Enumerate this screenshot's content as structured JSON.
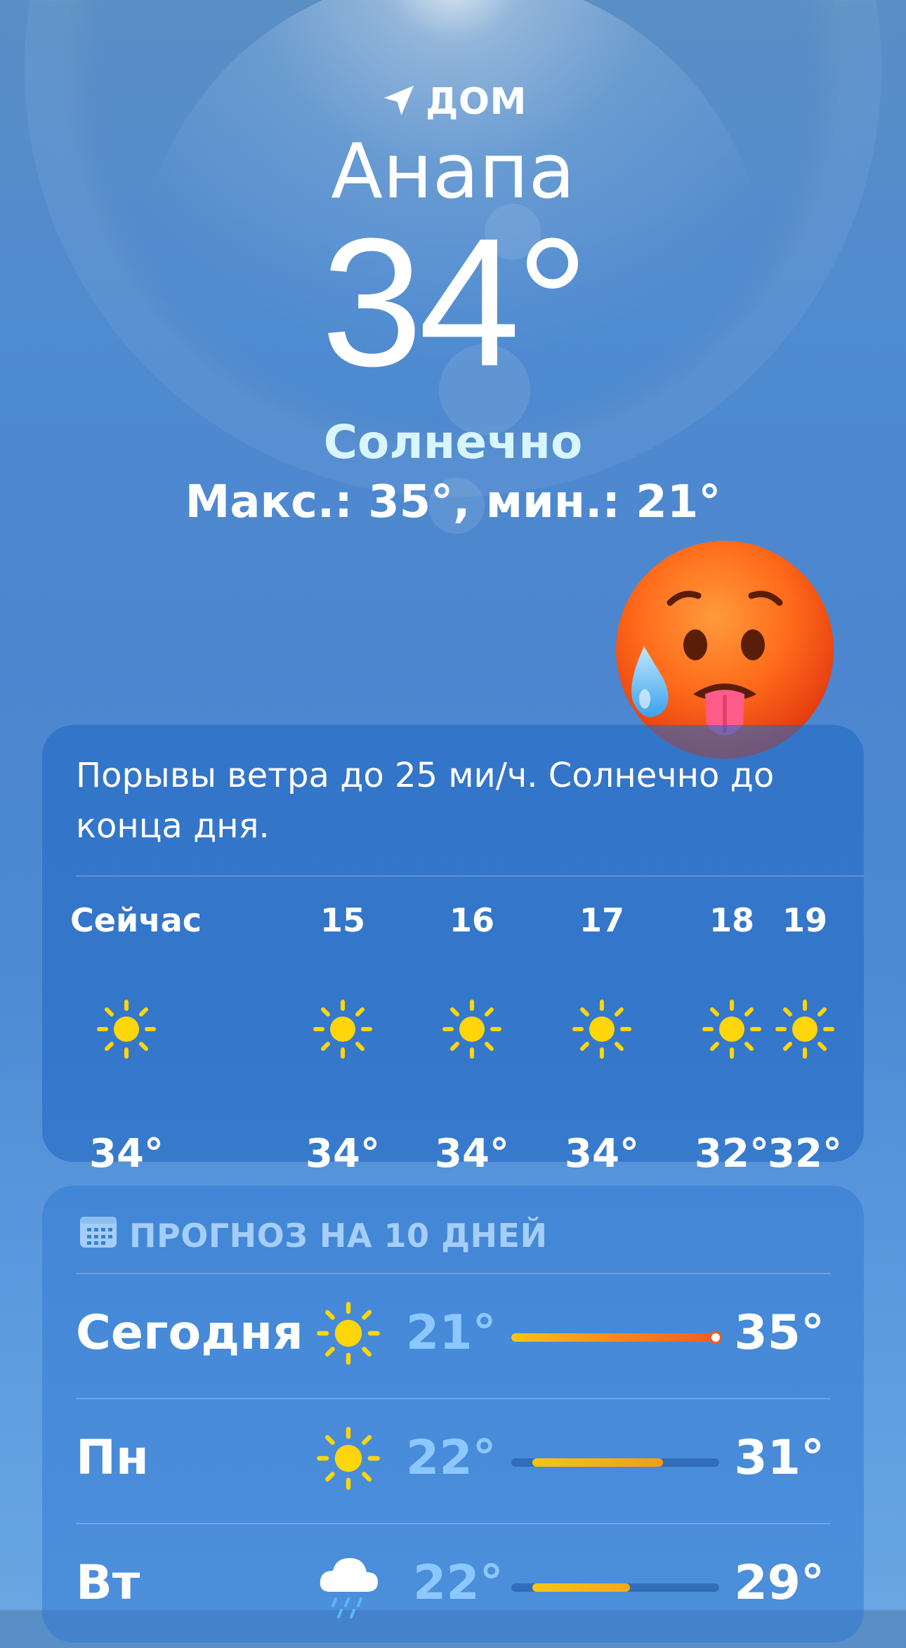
{
  "location": {
    "label": "ДОМ",
    "city": "Анапа",
    "temperature": "34°",
    "condition": "Солнечно",
    "high_low": "Макс.: 35°, мин.: 21°"
  },
  "emoji": "hot-face-with-sweat",
  "hourly": {
    "summary": "Порывы ветра до 25 ми/ч. Солнечно до конца дня.",
    "hours": [
      {
        "label": "Сейчас",
        "icon": "sun-icon",
        "temp": "34°"
      },
      {
        "label": "15",
        "icon": "sun-icon",
        "temp": "34°"
      },
      {
        "label": "16",
        "icon": "sun-icon",
        "temp": "34°"
      },
      {
        "label": "17",
        "icon": "sun-icon",
        "temp": "34°"
      },
      {
        "label": "18",
        "icon": "sun-icon",
        "temp": "32°"
      },
      {
        "label": "19",
        "icon": "sun-icon",
        "temp": "32°"
      }
    ]
  },
  "daily": {
    "title": "ПРОГНОЗ НА 10 ДНЕЙ",
    "days": [
      {
        "day": "Сегодня",
        "icon": "sun-icon",
        "low": "21°",
        "high": "35°",
        "range_start": 0.0,
        "range_end": 1.0,
        "current_marker": true
      },
      {
        "day": "Пн",
        "icon": "sun-icon",
        "low": "22°",
        "high": "31°",
        "range_start": 0.1,
        "range_end": 0.73
      },
      {
        "day": "Вт",
        "icon": "cloud-rain-icon",
        "low": "22°",
        "high": "29°",
        "range_start": 0.1,
        "range_end": 0.57
      }
    ]
  },
  "colors": {
    "sun": "#ffd60a",
    "low_temp": "#8cc8ff",
    "condition": "#d8f6ff"
  }
}
